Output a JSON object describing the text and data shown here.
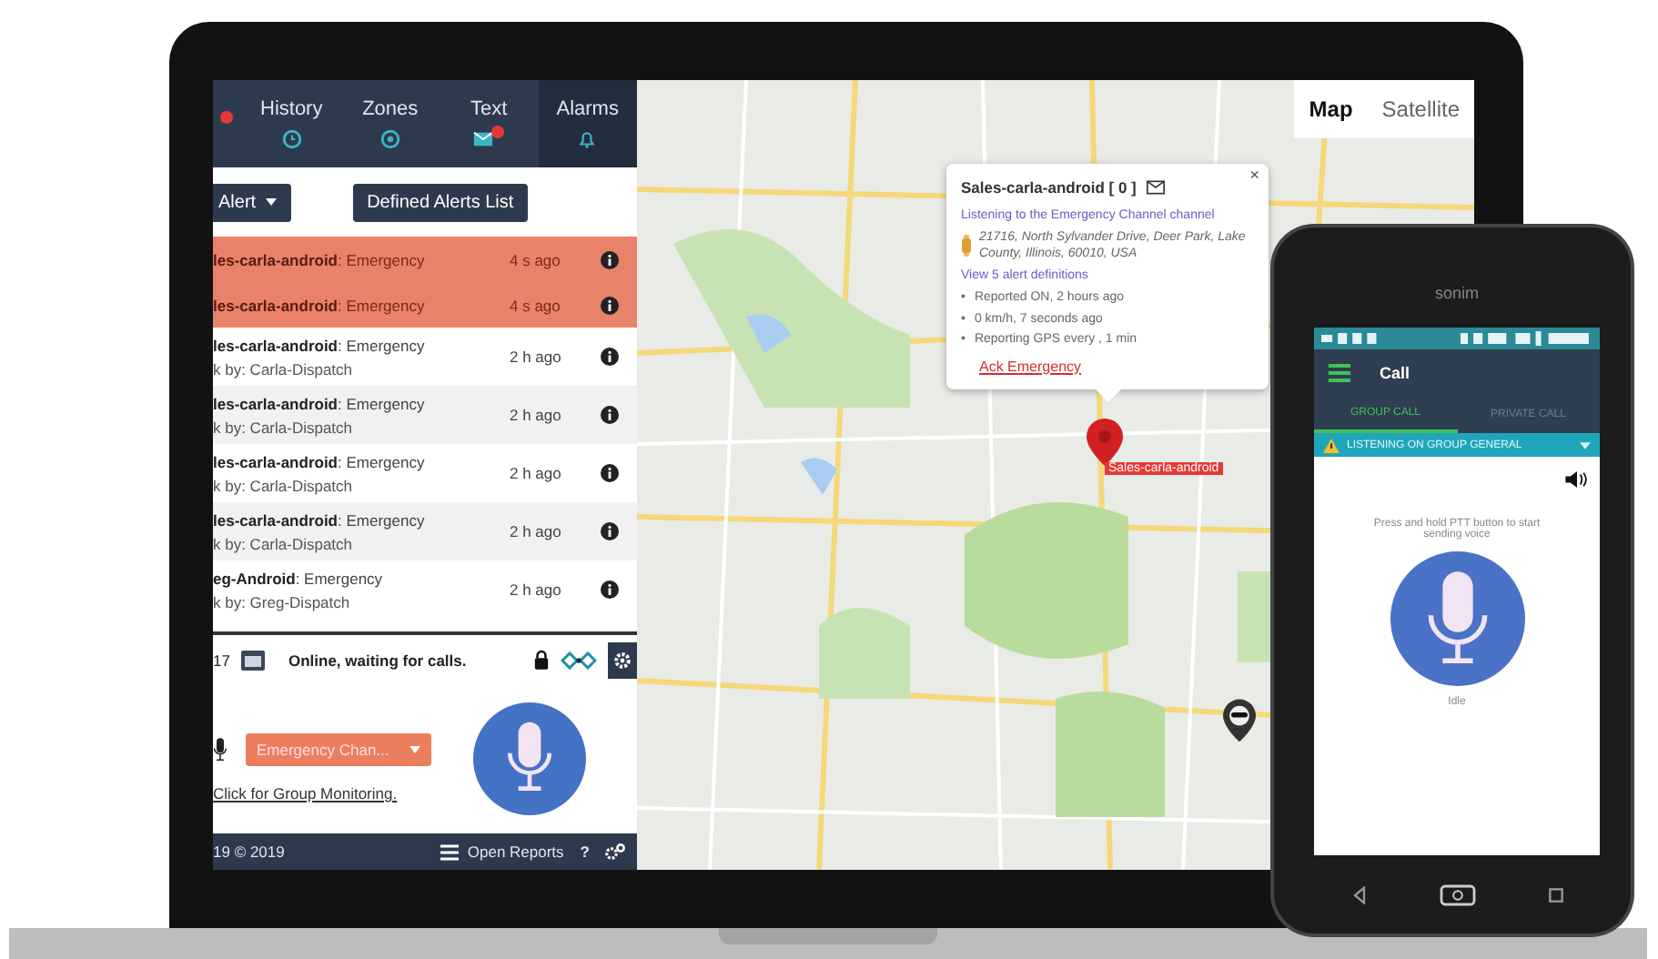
{
  "laptop": {
    "nav_tabs": [
      {
        "badge": true,
        "selected": false
      },
      {
        "label": "History",
        "badge": false,
        "selected": false
      },
      {
        "label": "Zones",
        "badge": false,
        "selected": false
      },
      {
        "label": "Text",
        "badge": true,
        "selected": false
      },
      {
        "label": "Alarms",
        "badge": false,
        "selected": true
      }
    ],
    "alert_buttons": [
      {
        "label": "Alert",
        "dropdown": true
      },
      {
        "label": "Defined Alerts List",
        "dropdown": false
      }
    ],
    "alerts": [
      {
        "text": "**les-carla-android**: Emergency",
        "time": "4 s ago",
        "emergency": true
      },
      {
        "text": "**les-carla-android**: Emergency",
        "time": "4 s ago",
        "emergency": true
      },
      {
        "text": "**les-carla-android**: Emergency",
        "ack": "k by: Carla-Dispatch",
        "time": "2 h ago",
        "emergency": false
      },
      {
        "text": "**les-carla-android**: Emergency",
        "ack": "k by: Carla-Dispatch",
        "time": "2 h ago",
        "emergency": false
      },
      {
        "text": "**les-carla-android**: Emergency",
        "ack": "k by: Carla-Dispatch",
        "time": "2 h ago",
        "emergency": false
      },
      {
        "text": "**les-carla-android**: Emergency",
        "ack": "k by: Carla-Dispatch",
        "time": "2 h ago",
        "emergency": false
      },
      {
        "text": "**eg-Android**: Emergency",
        "ack": "k by: Greg-Dispatch",
        "time": "2 h ago",
        "emergency": false
      }
    ],
    "status": {
      "number": "17",
      "message": "Online, waiting for calls.",
      "locked": true
    },
    "ptt": {
      "channel": "Emergency Chan...",
      "link": "Click for Group Monitoring."
    },
    "footer": {
      "version": "19 © 2019",
      "reports": "Open Reports",
      "help": "?"
    },
    "map": {
      "map_types": [
        {
          "label": "Map",
          "selected": true
        },
        {
          "label": "Satellite",
          "selected": false
        }
      ],
      "popup": {
        "title": "Sales-carla-android [ 0 ]",
        "channel": "Listening to the Emergency Channel channel",
        "address": "21716, North Sylvander Drive, Deer Park, Lake County, Illinois, 60010, USA",
        "link": "View 5 alert definitions",
        "facts": [
          {
            "bullet": "•",
            "text": "Reported ON, 2 hours ago"
          },
          {
            "bullet": "•",
            "text": "0 km/h, 7 seconds ago"
          },
          {
            "bullet": "•",
            "text": "Reporting GPS every , 1 min"
          }
        ],
        "action": "Ack Emergency",
        "close": "×"
      },
      "marker_label": "Sales-carla-android"
    }
  },
  "phone": {
    "brand": "sonim",
    "title": "Call",
    "tabs": [
      {
        "label": "GROUP CALL",
        "selected": true
      },
      {
        "label": "PRIVATE CALL",
        "selected": false
      }
    ],
    "banner": "LISTENING ON GROUP GENERAL",
    "hint": "Press and hold PTT button to start sending voice",
    "state": "Idle"
  }
}
